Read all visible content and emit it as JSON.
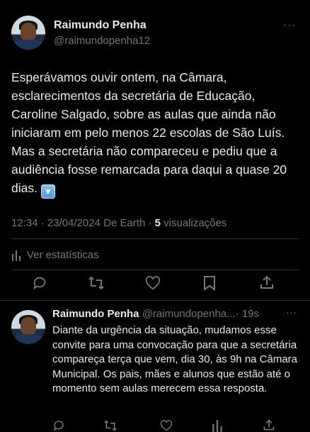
{
  "post": {
    "author_name": "Raimundo Penha",
    "author_handle": "@raimundopenha12",
    "more_label": "···",
    "text": "Esperávamos ouvir ontem, na Câmara, esclarecimentos da secretária de Educação, Caroline Salgado, sobre as aulas que ainda não iniciaram em pelo menos 22 escolas de São Luís. Mas a secretária não compareceu e pediu que a audiência fosse remarcada para daqui a quase 20 dias.",
    "emoji": "🔽",
    "meta_time": "12:34 · 23/04/2024 De Earth · ",
    "views_count": "5",
    "views_label": " visualizações",
    "stats_label": "Ver estatísticas"
  },
  "actions": [
    "reply-icon",
    "retweet-icon",
    "like-icon",
    "bookmark-icon",
    "share-icon"
  ],
  "reply": {
    "author_name": "Raimundo Penha",
    "author_handle": "@raimundopenha...",
    "time": "· 19s",
    "more_label": "···",
    "text": "Diante da urgência da situação, mudamos esse convite para uma convocação para que a secretária compareça terça que vem, dia 30, às 9h na Câmara Municipal. Os pais, mães e alunos que estão até o momento sem aulas merecem essa resposta."
  },
  "colors": {
    "background": "#000000",
    "text": "#e7e9ea",
    "muted": "#71767b",
    "divider": "#2f3336"
  }
}
